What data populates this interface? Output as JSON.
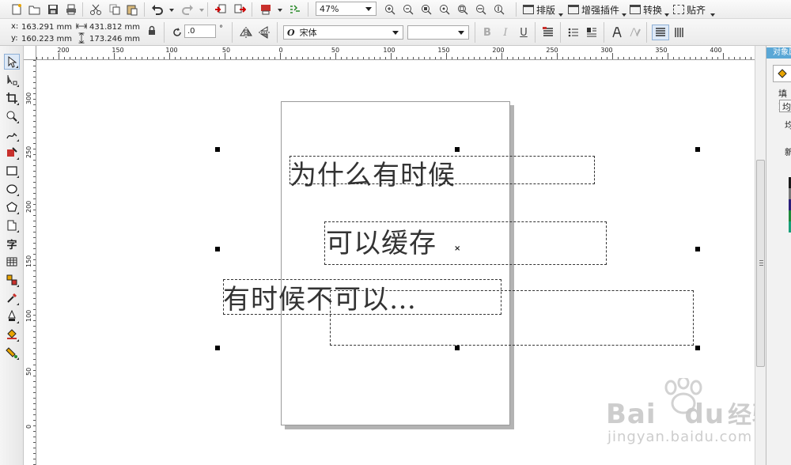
{
  "toolbar": {
    "zoom_value": "47%",
    "menus": [
      {
        "label": "排版"
      },
      {
        "label": "增强插件"
      },
      {
        "label": "转换"
      },
      {
        "label": "贴齐"
      }
    ]
  },
  "property_bar": {
    "x_label": "x:",
    "x_value": "163.291 mm",
    "y_label": "y:",
    "y_value": "160.223 mm",
    "width_value": "431.812 mm",
    "height_value": "173.246 mm",
    "rotation_value": ".0",
    "rotation_unit": "°",
    "font_style_glyph": "O",
    "font_name": "宋体",
    "font_size": ""
  },
  "ruler": {
    "h_labels": [
      "200",
      "150",
      "100",
      "50",
      "0",
      "50",
      "100",
      "150",
      "200",
      "250",
      "300",
      "350",
      "400"
    ],
    "v_labels": [
      "300",
      "250",
      "200",
      "150",
      "100",
      "50",
      "0"
    ]
  },
  "canvas": {
    "texts": [
      {
        "text": "为什么有时候"
      },
      {
        "text": "可以缓存"
      },
      {
        "text": "有时候不可以…"
      }
    ]
  },
  "docker": {
    "title": "对象属",
    "fill_label": "填充",
    "fill_type": "均",
    "partial_1": "均",
    "partial_2": "新"
  },
  "colors": {
    "accent": "#5aa7d6",
    "swatches": [
      "#1a1a1a",
      "#7a7a7a",
      "#2a1f7a",
      "#1e8a3a",
      "#18a07a"
    ]
  },
  "watermark": {
    "brand": "Bai",
    "brand_du": "du",
    "brand_cn": "经验",
    "url": "jingyan.baidu.com"
  }
}
